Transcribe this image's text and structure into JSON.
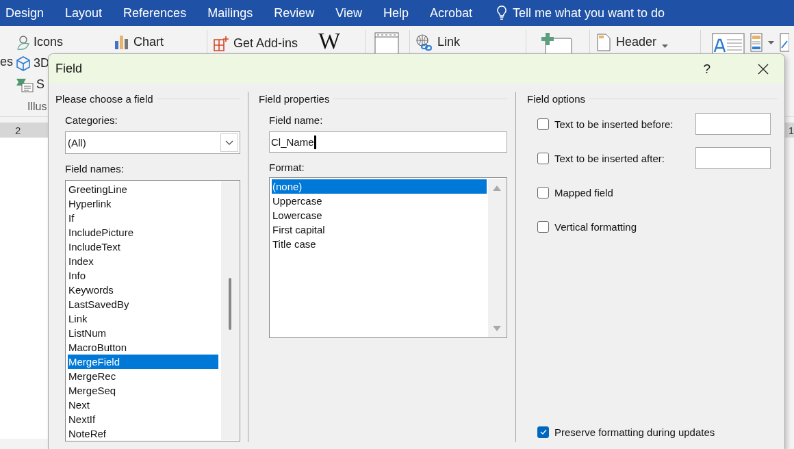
{
  "menu_tabs": [
    {
      "label": "Design"
    },
    {
      "label": "Layout"
    },
    {
      "label": "References"
    },
    {
      "label": "Mailings"
    },
    {
      "label": "Review"
    },
    {
      "label": "View"
    },
    {
      "label": "Help"
    },
    {
      "label": "Acrobat"
    }
  ],
  "tell_me": "Tell me what you want to do",
  "ribbon": {
    "cut_label": "es",
    "icons": "Icons",
    "three_d": "3D",
    "smartart": "S",
    "group_label": "Illus",
    "chart": "Chart",
    "add_ins": "Get Add-ins",
    "wiki_logo": "W",
    "link": "Link",
    "header": "Header"
  },
  "ruler": {
    "left_mark": "2",
    "right_mark": "1"
  },
  "dialog": {
    "title": "Field",
    "help": "?",
    "choose": {
      "heading": "Please choose a field",
      "categories_label": "Categories:",
      "category": "(All)",
      "names_label": "Field names:",
      "names": [
        {
          "label": "GreetingLine",
          "selected": false
        },
        {
          "label": "Hyperlink",
          "selected": false
        },
        {
          "label": "If",
          "selected": false
        },
        {
          "label": "IncludePicture",
          "selected": false
        },
        {
          "label": "IncludeText",
          "selected": false
        },
        {
          "label": "Index",
          "selected": false
        },
        {
          "label": "Info",
          "selected": false
        },
        {
          "label": "Keywords",
          "selected": false
        },
        {
          "label": "LastSavedBy",
          "selected": false
        },
        {
          "label": "Link",
          "selected": false
        },
        {
          "label": "ListNum",
          "selected": false
        },
        {
          "label": "MacroButton",
          "selected": false
        },
        {
          "label": "MergeField",
          "selected": true
        },
        {
          "label": "MergeRec",
          "selected": false
        },
        {
          "label": "MergeSeq",
          "selected": false
        },
        {
          "label": "Next",
          "selected": false
        },
        {
          "label": "NextIf",
          "selected": false
        },
        {
          "label": "NoteRef",
          "selected": false
        }
      ]
    },
    "properties": {
      "heading": "Field properties",
      "name_label": "Field name:",
      "name_value": "Cl_Name",
      "format_label": "Format:",
      "formats": [
        {
          "label": "(none)",
          "selected": true
        },
        {
          "label": "Uppercase",
          "selected": false
        },
        {
          "label": "Lowercase",
          "selected": false
        },
        {
          "label": "First capital",
          "selected": false
        },
        {
          "label": "Title case",
          "selected": false
        }
      ]
    },
    "options": {
      "heading": "Field options",
      "items": [
        {
          "kind": "with-field",
          "label": "Text to be inserted before:",
          "checked": false
        },
        {
          "kind": "with-field",
          "label": "Text to be inserted after:",
          "checked": false
        },
        {
          "kind": "plain",
          "label": "Mapped field",
          "checked": false
        },
        {
          "kind": "plain",
          "label": "Vertical formatting",
          "checked": false
        }
      ],
      "preserve": {
        "label": "Preserve formatting during updates",
        "checked": true
      }
    }
  }
}
